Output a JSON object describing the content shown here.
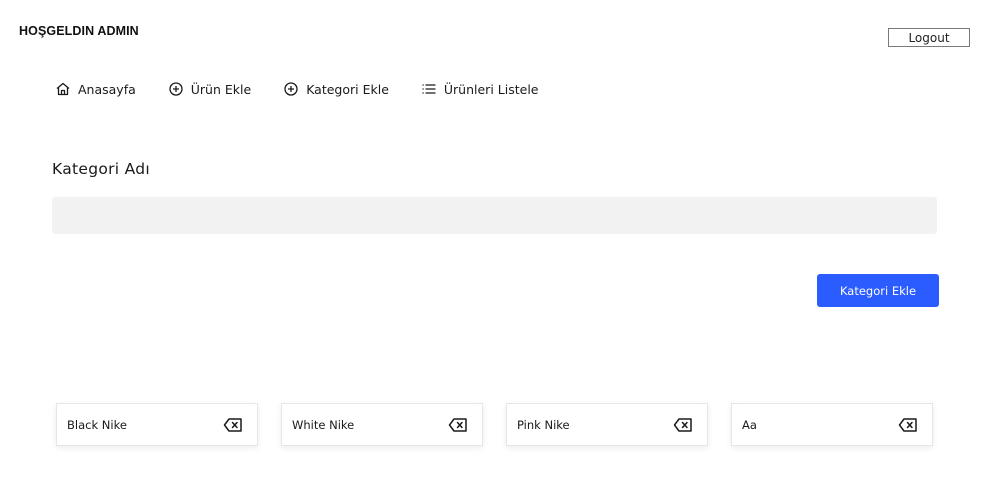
{
  "header": {
    "welcome": "HOŞGELDIN ADMIN",
    "logout_label": "Logout"
  },
  "nav": {
    "items": [
      {
        "label": "Anasayfa",
        "icon": "home-icon"
      },
      {
        "label": "Ürün Ekle",
        "icon": "plus-circle-icon"
      },
      {
        "label": "Kategori Ekle",
        "icon": "plus-circle-icon"
      },
      {
        "label": "Ürünleri Listele",
        "icon": "list-icon"
      }
    ]
  },
  "form": {
    "label": "Kategori Adı",
    "value": "",
    "submit_label": "Kategori Ekle",
    "accent_color": "#2a5cff"
  },
  "categories": [
    {
      "name": "Black Nike",
      "action_icon": "backspace-delete-icon"
    },
    {
      "name": "White Nike",
      "action_icon": "backspace-delete-icon"
    },
    {
      "name": "Pink Nike",
      "action_icon": "backspace-delete-icon"
    },
    {
      "name": "Aa",
      "action_icon": "backspace-delete-icon"
    }
  ]
}
